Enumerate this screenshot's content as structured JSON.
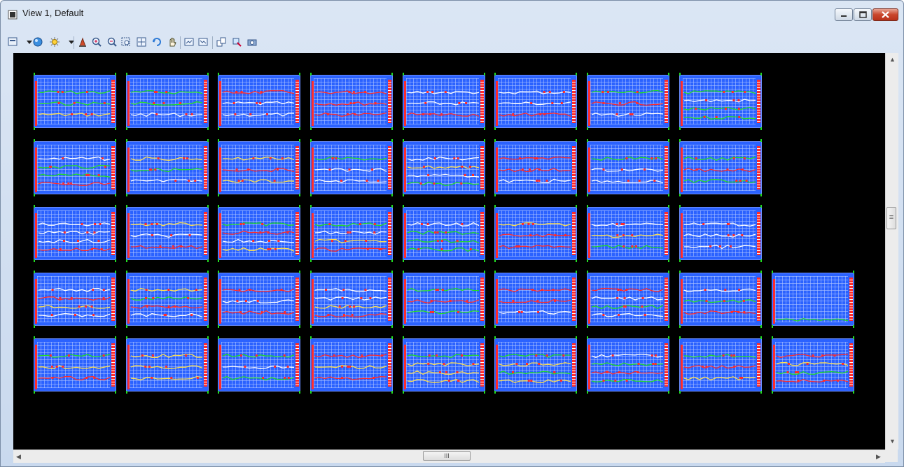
{
  "window": {
    "title": "View 1, Default",
    "controls": [
      "minimize",
      "maximize",
      "close"
    ]
  },
  "toolbar": {
    "tools": [
      {
        "name": "view-attributes-icon"
      },
      {
        "name": "dropdown-arrow-icon"
      },
      {
        "name": "display-style-icon"
      },
      {
        "name": "lights-icon"
      },
      {
        "name": "dropdown-arrow-icon"
      },
      {
        "name": "update-view-icon"
      },
      {
        "name": "zoom-in-icon"
      },
      {
        "name": "zoom-out-icon"
      },
      {
        "name": "window-area-icon"
      },
      {
        "name": "fit-view-icon"
      },
      {
        "name": "rotate-view-icon"
      },
      {
        "name": "pan-view-icon"
      },
      {
        "name": "view-previous-icon"
      },
      {
        "name": "view-next-icon"
      },
      {
        "name": "copy-view-icon"
      },
      {
        "name": "clip-volume-icon"
      },
      {
        "name": "camera-icon"
      }
    ]
  },
  "scrollbars": {
    "horizontal_grip": "III",
    "vertical_grip": "≡"
  },
  "drawing": {
    "rows": [
      {
        "sheets": 8
      },
      {
        "sheets": 8
      },
      {
        "sheets": 8
      },
      {
        "sheets": 9
      },
      {
        "sheets": 9
      }
    ],
    "colors": {
      "background": "#000000",
      "sheet": "#2b62ff",
      "grid": "#b4c8ff",
      "annotation_red": "#ff2b2b",
      "profile_white": "#ffffff",
      "profile_green": "#22dd22",
      "profile_yellow": "#ffe14d"
    }
  }
}
